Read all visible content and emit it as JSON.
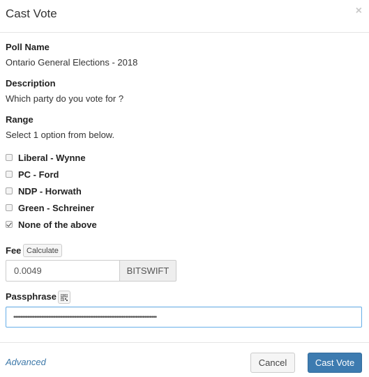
{
  "header": {
    "title": "Cast Vote",
    "close_symbol": "×"
  },
  "poll": {
    "name_label": "Poll Name",
    "name_value": "Ontario General Elections - 2018",
    "description_label": "Description",
    "description_value": "Which party do you vote for ?",
    "range_label": "Range",
    "range_value": "Select 1 option from below."
  },
  "options": [
    {
      "label": "Liberal - Wynne",
      "checked": false
    },
    {
      "label": "PC - Ford",
      "checked": false
    },
    {
      "label": "NDP - Horwath",
      "checked": false
    },
    {
      "label": "Green - Schreiner",
      "checked": false
    },
    {
      "label": "None of the above",
      "checked": true
    }
  ],
  "fee": {
    "label": "Fee",
    "calculate_label": "Calculate",
    "value": "0.0049",
    "currency": "BITSWIFT"
  },
  "passphrase": {
    "label": "Passphrase",
    "masked_value": "••••••••••••••••••••••••••••••••••••••••••••••••••••••••••••••••••••••••••••••••••"
  },
  "footer": {
    "advanced_label": "Advanced",
    "cancel_label": "Cancel",
    "submit_label": "Cast Vote"
  },
  "colors": {
    "primary": "#3d7bb0",
    "link": "#3b77a8",
    "focus_border": "#66afe9"
  },
  "icons": {
    "close": "close-icon",
    "qr": "qr-code-icon",
    "checkbox_check": "checkmark-icon"
  }
}
